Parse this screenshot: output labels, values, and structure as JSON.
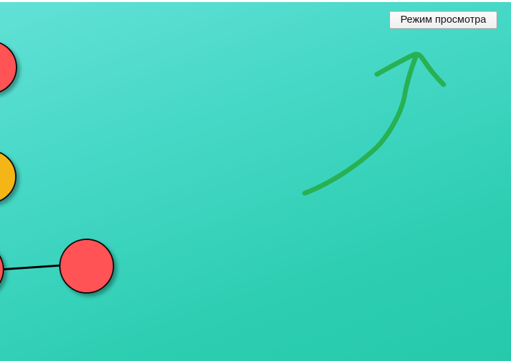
{
  "toolbar": {
    "view_mode_label": "Режим просмотра"
  },
  "colors": {
    "background_start": "#62e1d6",
    "background_end": "#27c9ad",
    "node_red": "#ff5257",
    "node_yellow": "#f4b617",
    "node_stroke": "#111111",
    "edge": "#000000",
    "drawing_green": "#27b153"
  },
  "icons": {
    "drawing": "hand-drawn-arrow-icon"
  }
}
